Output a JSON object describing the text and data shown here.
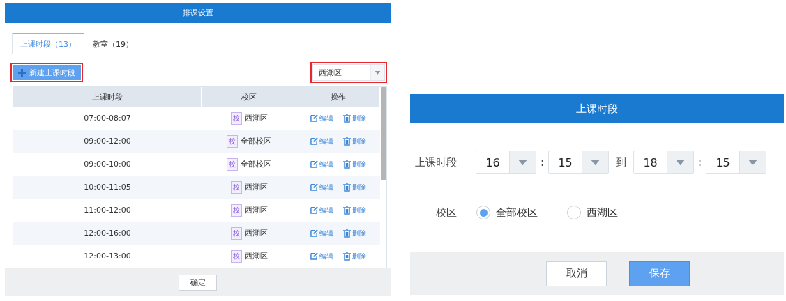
{
  "left_dialog": {
    "title": "排课设置",
    "tabs": [
      {
        "label": "上课时段（13）",
        "selected": true
      },
      {
        "label": "教室（19）",
        "selected": false
      }
    ],
    "new_button": {
      "label": "新建上课时段",
      "highlighted": true
    },
    "campus_select": {
      "value": "西湖区",
      "highlighted": true
    },
    "table": {
      "columns": [
        "上课时段",
        "校区",
        "操作"
      ],
      "rows": [
        {
          "time": "07:00-08:07",
          "badge": "校",
          "campus": "西湖区",
          "edit": "编辑",
          "delete": "删除"
        },
        {
          "time": "09:00-12:00",
          "badge": "校",
          "campus": "全部校区",
          "edit": "编辑",
          "delete": "删除"
        },
        {
          "time": "09:00-10:00",
          "badge": "校",
          "campus": "全部校区",
          "edit": "编辑",
          "delete": "删除"
        },
        {
          "time": "10:00-11:05",
          "badge": "校",
          "campus": "西湖区",
          "edit": "编辑",
          "delete": "删除"
        },
        {
          "time": "11:00-12:00",
          "badge": "校",
          "campus": "西湖区",
          "edit": "编辑",
          "delete": "删除"
        },
        {
          "time": "12:00-16:00",
          "badge": "校",
          "campus": "西湖区",
          "edit": "编辑",
          "delete": "删除"
        },
        {
          "time": "12:00-13:00",
          "badge": "校",
          "campus": "西湖区",
          "edit": "编辑",
          "delete": "删除"
        }
      ]
    },
    "confirm_button": "确定"
  },
  "right_dialog": {
    "title": "上课时段",
    "time_label": "上课时段",
    "start_hour": "16",
    "start_minute": "15",
    "separator_1": ":",
    "to": "到",
    "end_hour": "18",
    "separator_2": ":",
    "end_minute": "15",
    "campus_label": "校区",
    "campus_options": [
      {
        "label": "全部校区",
        "selected": true
      },
      {
        "label": "西湖区",
        "selected": false
      }
    ],
    "cancel_button": "取消",
    "save_button": "保存"
  }
}
